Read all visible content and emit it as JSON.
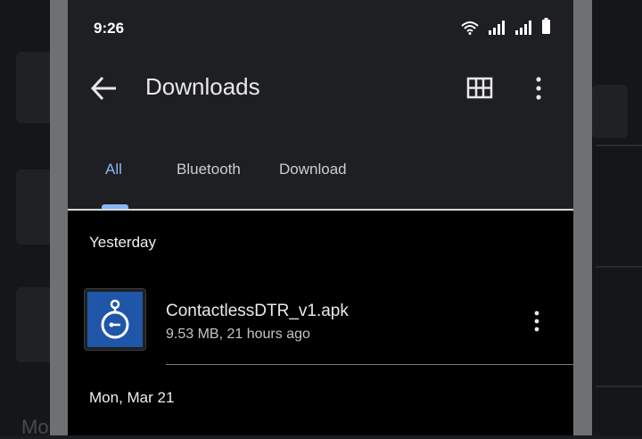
{
  "status_bar": {
    "time": "9:26"
  },
  "toolbar": {
    "title": "Downloads"
  },
  "tabs": [
    {
      "label": "All",
      "active": true
    },
    {
      "label": "Bluetooth",
      "active": false
    },
    {
      "label": "Download",
      "active": false
    }
  ],
  "sections": [
    {
      "heading": "Yesterday",
      "files": [
        {
          "name": "ContactlessDTR_v1.apk",
          "meta": "9.53 MB, 21 hours ago",
          "icon": "timer-app-icon"
        }
      ]
    },
    {
      "heading": "Mon, Mar 21",
      "files": []
    }
  ],
  "colors": {
    "accent": "#8ab4f8",
    "appbar": "#1e1f22",
    "icon_blue": "#1f56a8"
  }
}
